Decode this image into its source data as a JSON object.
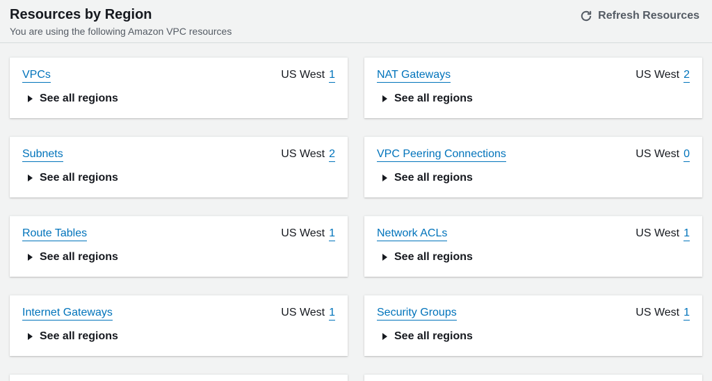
{
  "header": {
    "title": "Resources by Region",
    "subtitle": "You are using the following Amazon VPC resources",
    "refresh_label": "Refresh Resources"
  },
  "see_all_label": "See all regions",
  "cards": [
    {
      "title": "VPCs",
      "region": "US West",
      "count": "1"
    },
    {
      "title": "NAT Gateways",
      "region": "US West",
      "count": "2"
    },
    {
      "title": "Subnets",
      "region": "US West",
      "count": "2"
    },
    {
      "title": "VPC Peering Connections",
      "region": "US West",
      "count": "0"
    },
    {
      "title": "Route Tables",
      "region": "US West",
      "count": "1"
    },
    {
      "title": "Network ACLs",
      "region": "US West",
      "count": "1"
    },
    {
      "title": "Internet Gateways",
      "region": "US West",
      "count": "1"
    },
    {
      "title": "Security Groups",
      "region": "US West",
      "count": "1"
    }
  ]
}
